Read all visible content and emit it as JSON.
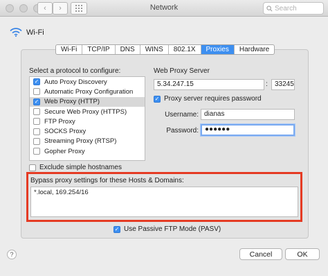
{
  "window": {
    "title": "Network"
  },
  "toolbar": {
    "back_icon": "chevron-left-icon",
    "forward_icon": "chevron-right-icon",
    "grid_icon": "grid-icon",
    "search_placeholder": "Search"
  },
  "interface": {
    "name": "Wi-Fi",
    "icon": "wifi-icon"
  },
  "tabs": [
    {
      "label": "Wi-Fi",
      "active": false
    },
    {
      "label": "TCP/IP",
      "active": false
    },
    {
      "label": "DNS",
      "active": false
    },
    {
      "label": "WINS",
      "active": false
    },
    {
      "label": "802.1X",
      "active": false
    },
    {
      "label": "Proxies",
      "active": true
    },
    {
      "label": "Hardware",
      "active": false
    }
  ],
  "protocols": {
    "heading": "Select a protocol to configure:",
    "items": [
      {
        "label": "Auto Proxy Discovery",
        "checked": true,
        "selected": false
      },
      {
        "label": "Automatic Proxy Configuration",
        "checked": false,
        "selected": false
      },
      {
        "label": "Web Proxy (HTTP)",
        "checked": true,
        "selected": true
      },
      {
        "label": "Secure Web Proxy (HTTPS)",
        "checked": false,
        "selected": false
      },
      {
        "label": "FTP Proxy",
        "checked": false,
        "selected": false
      },
      {
        "label": "SOCKS Proxy",
        "checked": false,
        "selected": false
      },
      {
        "label": "Streaming Proxy (RTSP)",
        "checked": false,
        "selected": false
      },
      {
        "label": "Gopher Proxy",
        "checked": false,
        "selected": false
      }
    ]
  },
  "server": {
    "heading": "Web Proxy Server",
    "host": "5.34.247.15",
    "port": "33245",
    "colon": ":",
    "auth_label": "Proxy server requires password",
    "auth_checked": true,
    "username_label": "Username:",
    "username": "dianas",
    "password_label": "Password:",
    "password": "●●●●●●"
  },
  "exclude": {
    "label": "Exclude simple hostnames",
    "checked": false
  },
  "bypass": {
    "label": "Bypass proxy settings for these Hosts & Domains:",
    "value": "*.local, 169.254/16"
  },
  "pasv": {
    "label": "Use Passive FTP Mode (PASV)",
    "checked": true
  },
  "buttons": {
    "help": "?",
    "cancel": "Cancel",
    "ok": "OK"
  },
  "colors": {
    "accent": "#3d8ff0",
    "highlight": "#e53b24"
  }
}
